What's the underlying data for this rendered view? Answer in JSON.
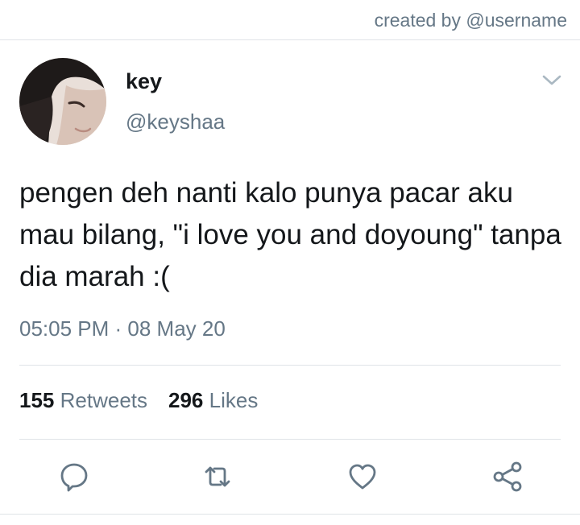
{
  "watermark": "created by @username",
  "tweet": {
    "author_name": "key",
    "author_handle": "@keyshaa",
    "text": "pengen deh nanti kalo punya pacar aku mau bilang, \"i love you and doyoung\" tanpa dia marah :(",
    "timestamp": "05:05 PM · 08 May 20",
    "retweets_count": "155",
    "retweets_label": "Retweets",
    "likes_count": "296",
    "likes_label": "Likes"
  },
  "icons": {
    "menu": "chevron-down-icon",
    "reply": "reply-icon",
    "retweet": "retweet-icon",
    "like": "heart-icon",
    "share": "share-icon"
  },
  "colors": {
    "text": "#14171a",
    "secondary": "#657786",
    "divider": "#dfe3e7"
  }
}
